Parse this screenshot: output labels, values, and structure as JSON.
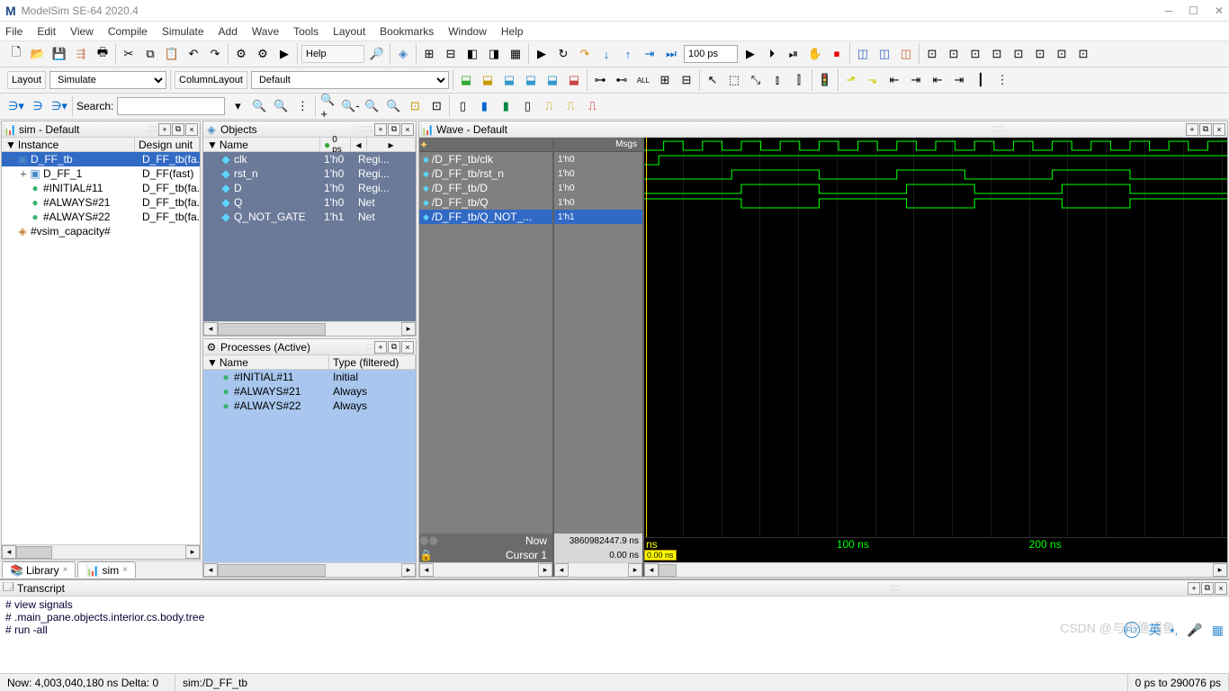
{
  "app": {
    "title": "ModelSim SE-64 2020.4",
    "logo": "M"
  },
  "menu": [
    "File",
    "Edit",
    "View",
    "Compile",
    "Simulate",
    "Add",
    "Wave",
    "Tools",
    "Layout",
    "Bookmarks",
    "Window",
    "Help"
  ],
  "toolbar": {
    "help_label": "Help",
    "time_box": "100 ps",
    "layout_label": "Layout",
    "layout_value": "Simulate",
    "col_layout_label": "ColumnLayout",
    "col_layout_value": "Default",
    "search_label": "Search:"
  },
  "sim_pane": {
    "title": "sim - Default",
    "cols": [
      "Instance",
      "Design unit"
    ],
    "rows": [
      {
        "indent": 0,
        "exp": "-",
        "icon": "module",
        "name": "D_FF_tb",
        "du": "D_FF_tb(fa...",
        "sel": true
      },
      {
        "indent": 1,
        "exp": "+",
        "icon": "module",
        "name": "D_FF_1",
        "du": "D_FF(fast)"
      },
      {
        "indent": 1,
        "exp": "",
        "icon": "process",
        "name": "#INITIAL#11",
        "du": "D_FF_tb(fa..."
      },
      {
        "indent": 1,
        "exp": "",
        "icon": "process",
        "name": "#ALWAYS#21",
        "du": "D_FF_tb(fa..."
      },
      {
        "indent": 1,
        "exp": "",
        "icon": "process",
        "name": "#ALWAYS#22",
        "du": "D_FF_tb(fa..."
      },
      {
        "indent": 0,
        "exp": "",
        "icon": "capacity",
        "name": "#vsim_capacity#",
        "du": ""
      }
    ],
    "tabs": [
      {
        "icon": "📚",
        "label": "Library"
      },
      {
        "icon": "📊",
        "label": "sim"
      }
    ]
  },
  "objects_pane": {
    "title": "Objects",
    "header_time": "0 ps",
    "cols": [
      "Name",
      "",
      "",
      ""
    ],
    "rows": [
      {
        "name": "clk",
        "val": "1'h0",
        "kind": "Regi..."
      },
      {
        "name": "rst_n",
        "val": "1'h0",
        "kind": "Regi..."
      },
      {
        "name": "D",
        "val": "1'h0",
        "kind": "Regi..."
      },
      {
        "name": "Q",
        "val": "1'h0",
        "kind": "Net"
      },
      {
        "name": "Q_NOT_GATE",
        "val": "1'h1",
        "kind": "Net"
      }
    ]
  },
  "processes_pane": {
    "title": "Processes (Active)",
    "cols": [
      "Name",
      "Type (filtered)"
    ],
    "rows": [
      {
        "name": "#INITIAL#11",
        "type": "Initial"
      },
      {
        "name": "#ALWAYS#21",
        "type": "Always"
      },
      {
        "name": "#ALWAYS#22",
        "type": "Always"
      }
    ]
  },
  "wave_pane": {
    "title": "Wave - Default",
    "msgs_label": "Msgs",
    "signals": [
      {
        "name": "/D_FF_tb/clk",
        "val": "1'h0"
      },
      {
        "name": "/D_FF_tb/rst_n",
        "val": "1'h0"
      },
      {
        "name": "/D_FF_tb/D",
        "val": "1'h0"
      },
      {
        "name": "/D_FF_tb/Q",
        "val": "1'h0"
      },
      {
        "name": "/D_FF_tb/Q_NOT_...",
        "val": "1'h1",
        "sel": true
      }
    ],
    "now_label": "Now",
    "now_value": "3860982447.9 ns",
    "cursor_label": "Cursor 1",
    "cursor_value": "0.00 ns",
    "ruler_unit": "ns",
    "ruler_ticks": [
      "100 ns",
      "200 ns"
    ],
    "cursor_pos_label": "0.00 ns",
    "range_label": "0 ps to 290076 ps"
  },
  "transcript": {
    "title": "Transcript",
    "lines": [
      "# view signals",
      "# .main_pane.objects.interior.cs.body.tree",
      "# run -all"
    ]
  },
  "status": {
    "now": "Now: 4,003,040,180 ns   Delta: 0",
    "context": "sim:/D_FF_tb"
  },
  "watermark": "CSDN @与雨渔遇鱼"
}
